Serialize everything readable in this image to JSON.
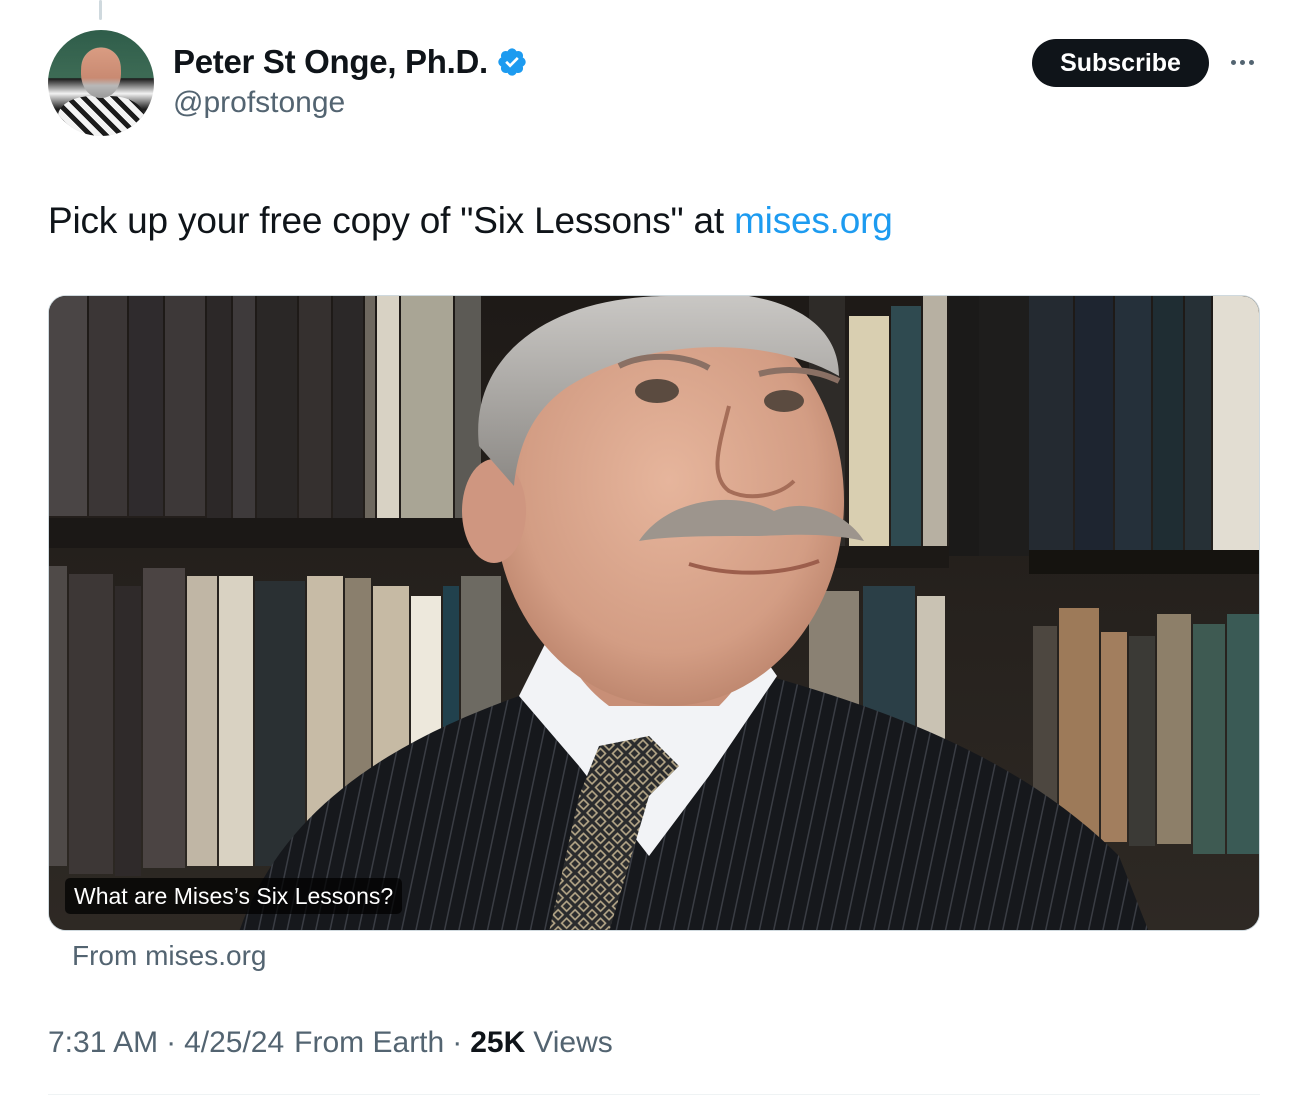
{
  "author": {
    "display_name": "Peter St Onge, Ph.D.",
    "handle": "@profstonge",
    "verified": true,
    "verified_color": "#1d9bf0"
  },
  "header": {
    "subscribe_label": "Subscribe",
    "more_icon": "more-horizontal-icon"
  },
  "tweet": {
    "text_prefix": "Pick up your free copy of \"Six Lessons\" at ",
    "link_text": "mises.org",
    "link_color": "#1d9bf0"
  },
  "card": {
    "caption": "What are Mises’s Six Lessons?",
    "from": "From mises.org"
  },
  "meta": {
    "time": "7:31 AM",
    "date": "4/25/24",
    "location": "From Earth",
    "views_count": "25K",
    "views_label": "Views"
  }
}
